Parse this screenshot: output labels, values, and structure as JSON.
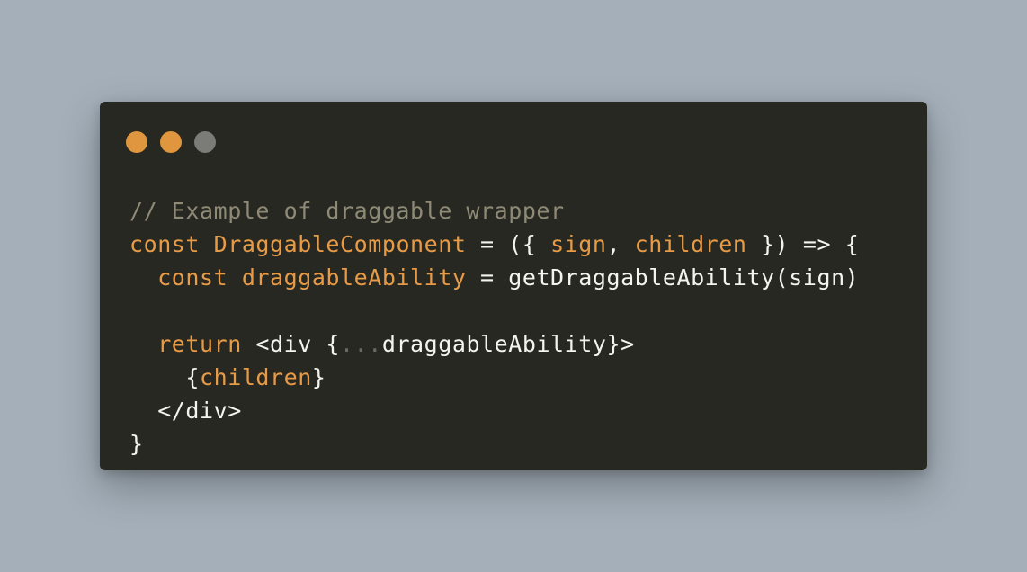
{
  "background_color": "#a4afb9",
  "window": {
    "background_color": "#272822",
    "controls": [
      {
        "name": "close",
        "color": "#e0963e"
      },
      {
        "name": "minimize",
        "color": "#e0963e"
      },
      {
        "name": "zoom",
        "color": "#7b7c78"
      }
    ]
  },
  "code": {
    "language": "javascript",
    "colors": {
      "comment": "#8f8a76",
      "keyword": "#e79b47",
      "plain": "#f4f4ee",
      "dim": "#6a6a62"
    },
    "lines": [
      {
        "tokens": [
          {
            "t": "// Example of draggable wrapper",
            "k": "comment"
          }
        ]
      },
      {
        "tokens": [
          {
            "t": "const",
            "k": "keyword"
          },
          {
            "t": " ",
            "k": "plain"
          },
          {
            "t": "DraggableComponent",
            "k": "keyword"
          },
          {
            "t": " = ({ ",
            "k": "plain"
          },
          {
            "t": "sign",
            "k": "param"
          },
          {
            "t": ", ",
            "k": "plain"
          },
          {
            "t": "children",
            "k": "param"
          },
          {
            "t": " }) => {",
            "k": "plain"
          }
        ]
      },
      {
        "tokens": [
          {
            "t": "  ",
            "k": "plain"
          },
          {
            "t": "const",
            "k": "keyword"
          },
          {
            "t": " ",
            "k": "plain"
          },
          {
            "t": "draggableAbility",
            "k": "keyword"
          },
          {
            "t": " = getDraggableAbility(sign)",
            "k": "plain"
          }
        ]
      },
      {
        "tokens": [
          {
            "t": "",
            "k": "plain"
          }
        ]
      },
      {
        "tokens": [
          {
            "t": "  ",
            "k": "plain"
          },
          {
            "t": "return",
            "k": "keyword"
          },
          {
            "t": " <div {",
            "k": "plain"
          },
          {
            "t": "...",
            "k": "dim"
          },
          {
            "t": "draggableAbility}>",
            "k": "plain"
          }
        ]
      },
      {
        "tokens": [
          {
            "t": "    {",
            "k": "plain"
          },
          {
            "t": "children",
            "k": "param"
          },
          {
            "t": "}",
            "k": "plain"
          }
        ]
      },
      {
        "tokens": [
          {
            "t": "  </div>",
            "k": "plain"
          }
        ]
      },
      {
        "tokens": [
          {
            "t": "}",
            "k": "plain"
          }
        ]
      }
    ]
  }
}
